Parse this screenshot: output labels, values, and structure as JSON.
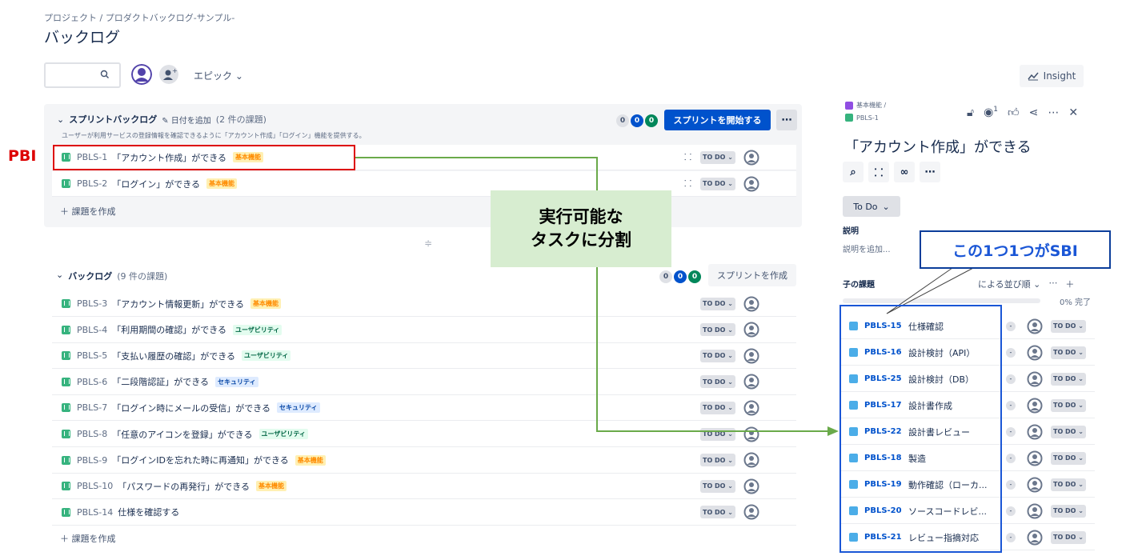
{
  "breadcrumb": "プロジェクト / プロダクトバックログ-サンプル-",
  "page_title": "バックログ",
  "epic_filter": "エピック",
  "insight_label": "Insight",
  "sprint": {
    "title": "スプリントバックログ",
    "add_date": "日付を追加",
    "count": "(2 件の課題)",
    "description": "ユーザーが利用サービスの登録情報を確認できるように「アカウント作成」「ログイン」機能を提供する。",
    "counts": [
      "0",
      "0",
      "0"
    ],
    "start_button": "スプリントを開始する",
    "create_issue": "＋ 課題を作成",
    "items": [
      {
        "key": "PBLS-1",
        "title": "「アカウント作成」ができる",
        "label": "基本機能",
        "status": "TO DO"
      },
      {
        "key": "PBLS-2",
        "title": "「ログイン」ができる",
        "label": "基本機能",
        "status": "TO DO"
      }
    ]
  },
  "backlog": {
    "title": "バックログ",
    "count": "(9 件の課題)",
    "counts": [
      "0",
      "0",
      "0"
    ],
    "create_sprint": "スプリントを作成",
    "create_issue": "＋ 課題を作成",
    "items": [
      {
        "key": "PBLS-3",
        "title": "「アカウント情報更新」ができる",
        "label": "基本機能",
        "status": "TO DO"
      },
      {
        "key": "PBLS-4",
        "title": "「利用期間の確認」ができる",
        "label": "ユーザビリティ",
        "status": "TO DO"
      },
      {
        "key": "PBLS-5",
        "title": "「支払い履歴の確認」ができる",
        "label": "ユーザビリティ",
        "status": "TO DO"
      },
      {
        "key": "PBLS-6",
        "title": "「二段階認証」ができる",
        "label": "セキュリティ",
        "status": "TO DO"
      },
      {
        "key": "PBLS-7",
        "title": "「ログイン時にメールの受信」ができる",
        "label": "セキュリティ",
        "status": "TO DO"
      },
      {
        "key": "PBLS-8",
        "title": "「任意のアイコンを登録」ができる",
        "label": "ユーザビリティ",
        "status": "TO DO"
      },
      {
        "key": "PBLS-9",
        "title": "「ログインIDを忘れた時に再通知」ができる",
        "label": "基本機能",
        "status": "TO DO"
      },
      {
        "key": "PBLS-10",
        "title": "「パスワードの再発行」ができる",
        "label": "基本機能",
        "status": "TO DO"
      },
      {
        "key": "PBLS-14",
        "title": "仕様を確認する",
        "label": "",
        "status": "TO DO"
      }
    ]
  },
  "detail": {
    "parent_crumb": "基本機能 /",
    "issue_crumb": "PBLS-1",
    "watchers": "1",
    "title": "「アカウント作成」ができる",
    "status": "To Do",
    "description_heading": "説明",
    "description_placeholder": "説明を追加...",
    "children_heading": "子の課題",
    "sort_label": "による並び順",
    "progress": "0% 完了",
    "progress_value": 0,
    "children": [
      {
        "key": "PBLS-15",
        "title": "仕様確認",
        "status": "TO DO"
      },
      {
        "key": "PBLS-16",
        "title": "設計検討（API）",
        "status": "TO DO"
      },
      {
        "key": "PBLS-25",
        "title": "設計検討（DB）",
        "status": "TO DO"
      },
      {
        "key": "PBLS-17",
        "title": "設計書作成",
        "status": "TO DO"
      },
      {
        "key": "PBLS-22",
        "title": "設計書レビュー",
        "status": "TO DO"
      },
      {
        "key": "PBLS-18",
        "title": "製造",
        "status": "TO DO"
      },
      {
        "key": "PBLS-19",
        "title": "動作確認（ローカ...",
        "status": "TO DO"
      },
      {
        "key": "PBLS-20",
        "title": "ソースコードレビ...",
        "status": "TO DO"
      },
      {
        "key": "PBLS-21",
        "title": "レビュー指摘対応",
        "status": "TO DO"
      }
    ]
  },
  "annotations": {
    "pbi": "PBI",
    "callout_line1": "実行可能な",
    "callout_line2": "タスクに分割",
    "sbi": "この1つ1つがSBI"
  },
  "colors": {
    "accent": "#0052cc",
    "annotation_red": "#dd0000",
    "annotation_green": "#6aaa4a",
    "callout_bg": "#d7edd0"
  }
}
